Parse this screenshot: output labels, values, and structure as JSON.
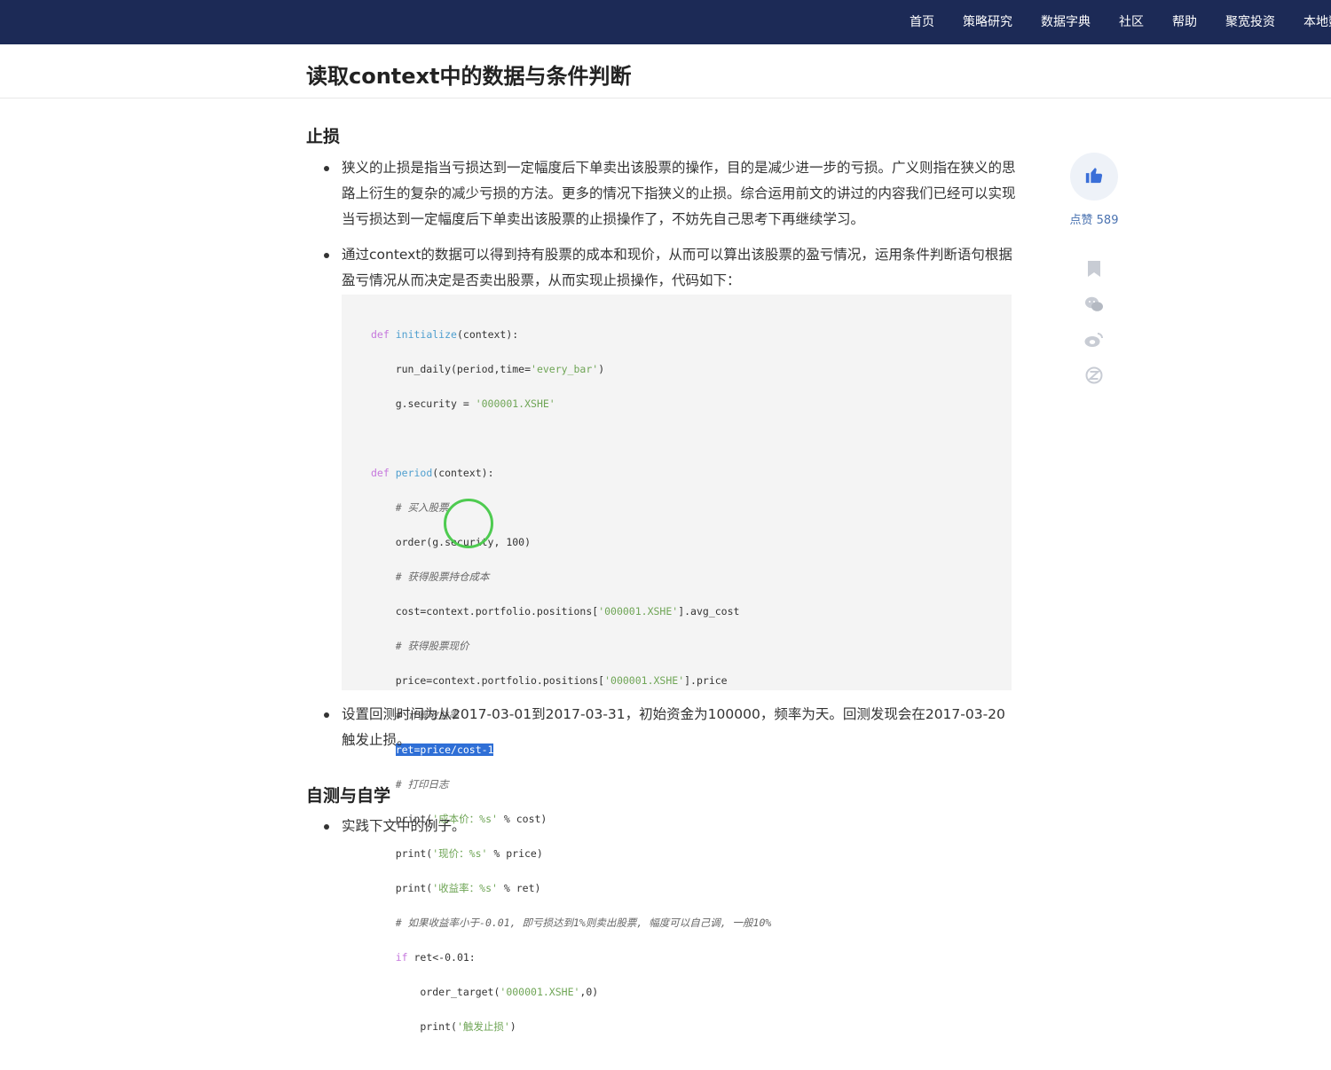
{
  "nav": {
    "items": [
      "首页",
      "策略研究",
      "数据字典",
      "社区",
      "帮助",
      "聚宽投资",
      "本地数据"
    ]
  },
  "page": {
    "title": "读取context中的数据与条件判断"
  },
  "sections": {
    "stop_loss": {
      "heading": "止损",
      "p1": "狭义的止损是指当亏损达到一定幅度后下单卖出该股票的操作，目的是减少进一步的亏损。广义则指在狭义的思路上衍生的复杂的减少亏损的方法。更多的情况下指狭义的止损。综合运用前文的讲过的内容我们已经可以实现当亏损达到一定幅度后下单卖出该股票的止损操作了，不妨先自己思考下再继续学习。",
      "p2": "通过context的数据可以得到持有股票的成本和现价，从而可以算出该股票的盈亏情况，运用条件判断语句根据盈亏情况从而决定是否卖出股票，从而实现止损操作，代码如下：",
      "p3": "设置回测时间为从2017-03-01到2017-03-31，初始资金为100000，频率为天。回测发现会在2017-03-20触发止损。"
    },
    "self_study": {
      "heading": "自测与自学",
      "p1": "实践下文中的例子。"
    }
  },
  "code": {
    "l1_kw": "def",
    "l1_fn": "initialize",
    "l1_rest": "(context):",
    "l2_a": "    run_daily(period,time=",
    "l2_str": "'every_bar'",
    "l2_b": ")",
    "l3_a": "    g.security = ",
    "l3_str": "'000001.XSHE'",
    "l5_kw": "def",
    "l5_fn": "period",
    "l5_rest": "(context):",
    "l6": "    # 买入股票",
    "l7": "    order(g.security, 100)",
    "l8": "    # 获得股票持仓成本",
    "l9_a": "    cost=context.portfolio.positions[",
    "l9_str": "'000001.XSHE'",
    "l9_b": "].avg_cost",
    "l10": "    # 获得股票现价",
    "l11_a": "    price=context.portfolio.positions[",
    "l11_str": "'000001.XSHE'",
    "l11_b": "].price",
    "l12": "    # 计算收益率",
    "l13_sel": "ret=price/cost-1",
    "l14": "    # 打印日志",
    "l15_a": "    print(",
    "l15_str": "'成本价：%s'",
    "l15_b": " % cost)",
    "l16_a": "    print(",
    "l16_str": "'现价：%s'",
    "l16_b": " % price)",
    "l17_a": "    print(",
    "l17_str": "'收益率：%s'",
    "l17_b": " % ret)",
    "l18": "    # 如果收益率小于-0.01, 即亏损达到1%则卖出股票, 幅度可以自己调, 一般10%",
    "l19_kw": "if",
    "l19_rest": " ret<-0.01:",
    "l20_a": "        order_target(",
    "l20_str": "'000001.XSHE'",
    "l20_b": ",0)",
    "l21_a": "        print(",
    "l21_str": "'触发止损'",
    "l21_b": ")"
  },
  "sidebar": {
    "like_label": "点赞 589",
    "icons": [
      "thumbs-up-icon",
      "bookmark-icon",
      "wechat-icon",
      "weibo-icon",
      "qzone-icon"
    ]
  },
  "colors": {
    "nav_bg": "#1c2a56",
    "selection": "#2f6fd6",
    "click_ring": "#4ecb50",
    "accent": "#3a6fd8"
  }
}
